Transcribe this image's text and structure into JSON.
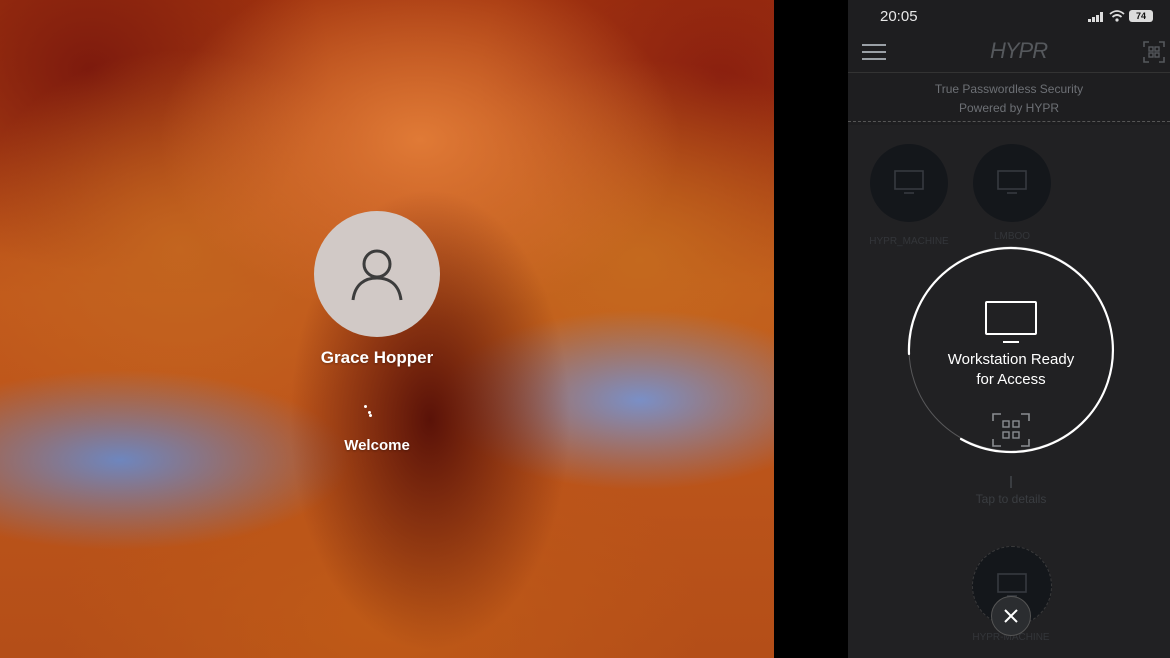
{
  "lock_screen": {
    "user_name": "Grace Hopper",
    "status": "Welcome",
    "avatar_icon": "user-icon"
  },
  "phone": {
    "status_bar": {
      "time": "20:05",
      "battery": "74"
    },
    "header": {
      "logo": "HYPR",
      "menu_icon": "hamburger-menu-icon",
      "qr_icon": "qr-scan-icon"
    },
    "tagline": {
      "line1": "True Passwordless Security",
      "line2": "Powered by HYPR"
    },
    "devices": [
      {
        "label": "HYPR_MACHINE",
        "icon": "monitor-icon"
      },
      {
        "label": "LMBOO",
        "icon": "monitor-icon"
      }
    ],
    "bottom_device": {
      "label": "HYPR-MACHINE",
      "icon": "monitor-icon"
    },
    "ready": {
      "line1": "Workstation Ready",
      "line2": "for Access",
      "monitor_icon": "monitor-icon",
      "qr_icon": "qr-scan-icon"
    },
    "hint": "Tap to details",
    "close_icon": "close-icon"
  },
  "colors": {
    "phone_bg": "#1e1e20",
    "device_bg": "#0a0e13",
    "ring": "#ffffff"
  }
}
